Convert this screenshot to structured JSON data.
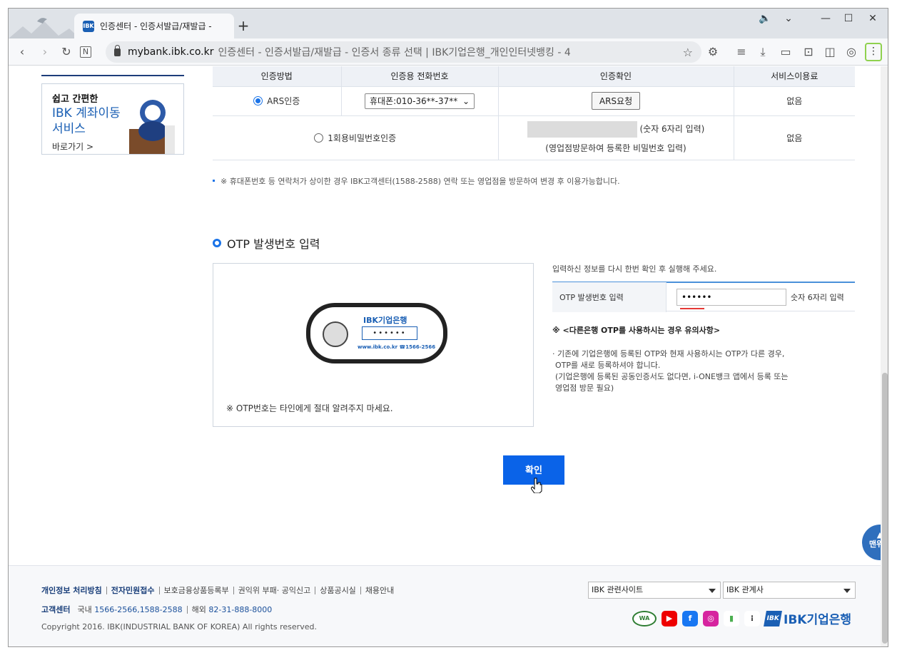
{
  "browser": {
    "tab_title": "인증센터 - 인증서발급/재발급 -",
    "tab_favicon": "IBK",
    "new_tab": "+",
    "url_domain": "mybank.ibk.co.kr",
    "url_rest": "인증센터 - 인증서발급/재발급 - 인증서 종류 선택 | IBK기업은행_개인인터넷뱅킹 - 4",
    "menu": "⋮"
  },
  "banner": {
    "line1": "쉽고 간편한",
    "line2": "IBK 계좌이동",
    "line3": "서비스",
    "link": "바로가기 >"
  },
  "auth_table": {
    "headers": [
      "인증방법",
      "인증용 전화번호",
      "인증확인",
      "서비스이용료"
    ],
    "row1": {
      "method": "ARS인증",
      "phone": "휴대폰:010-36**-37**",
      "button": "ARS요청",
      "fee": "없음"
    },
    "row2": {
      "method": "1회용비밀번호인증",
      "hint": "(숫자 6자리 입력)",
      "subhint": "(영업점방문하여 등록한 비밀번호 입력)",
      "fee": "없음"
    }
  },
  "note": "※ 휴대폰번호 등 연락처가 상이한 경우 IBK고객센터(1588-2588) 연락 또는 영업점을 방문하여 변경 후 이용가능합니다.",
  "otp": {
    "title": "OTP 발생번호 입력",
    "token_logo": "IBK기업은행",
    "token_display": "••••••",
    "token_footer": "www.ibk.co.kr ☎1566-2566",
    "warning": "※ OTP번호는 타인에게 절대 알려주지 마세요.",
    "instruction": "입력하신 정보를 다시 한번 확인 후 실행해 주세요.",
    "field_label": "OTP 발생번호 입력",
    "field_value": "••••••",
    "field_hint": "숫자 6자리 입력",
    "notice_title": "※ <다른은행 OTP를 사용하시는 경우 유의사항>",
    "notice_lines": [
      "· 기존에 기업은행에 등록된 OTP와 현재 사용하시는 OTP가 다른 경우,",
      "  OTP를 새로 등록하셔야 합니다.",
      "  (기업은행에 등록된 공동인증서도 없다면, i-ONE뱅크 앱에서 등록 또는",
      "  영업점 방문 필요)"
    ]
  },
  "confirm_label": "확인",
  "top_button": "맨위로",
  "footer": {
    "links": [
      "개인정보 처리방침",
      "전자민원접수",
      "보호금융상품등록부",
      "권익위 부패· 공익신고",
      "상품공시실",
      "채용안내"
    ],
    "cs_label": "고객센터",
    "cs_domestic_label": "국내",
    "cs_domestic": "1566-2566,1588-2588",
    "cs_abroad_label": "해외",
    "cs_abroad": "82-31-888-8000",
    "copyright": "Copyright 2016. IBK(INDUSTRIAL BANK OF KOREA) All rights reserved.",
    "select1": "IBK 관련사이트",
    "select2": "IBK 관계사",
    "logo": "IBK기업은행",
    "social_icons": [
      "wa-mark-icon",
      "youtube-icon",
      "facebook-icon",
      "instagram-icon",
      "kakaostory-icon",
      "tstory-icon"
    ]
  },
  "colors": {
    "primary": "#0a63e8",
    "brand": "#1a5fb4",
    "navy": "#1a3f7a"
  }
}
